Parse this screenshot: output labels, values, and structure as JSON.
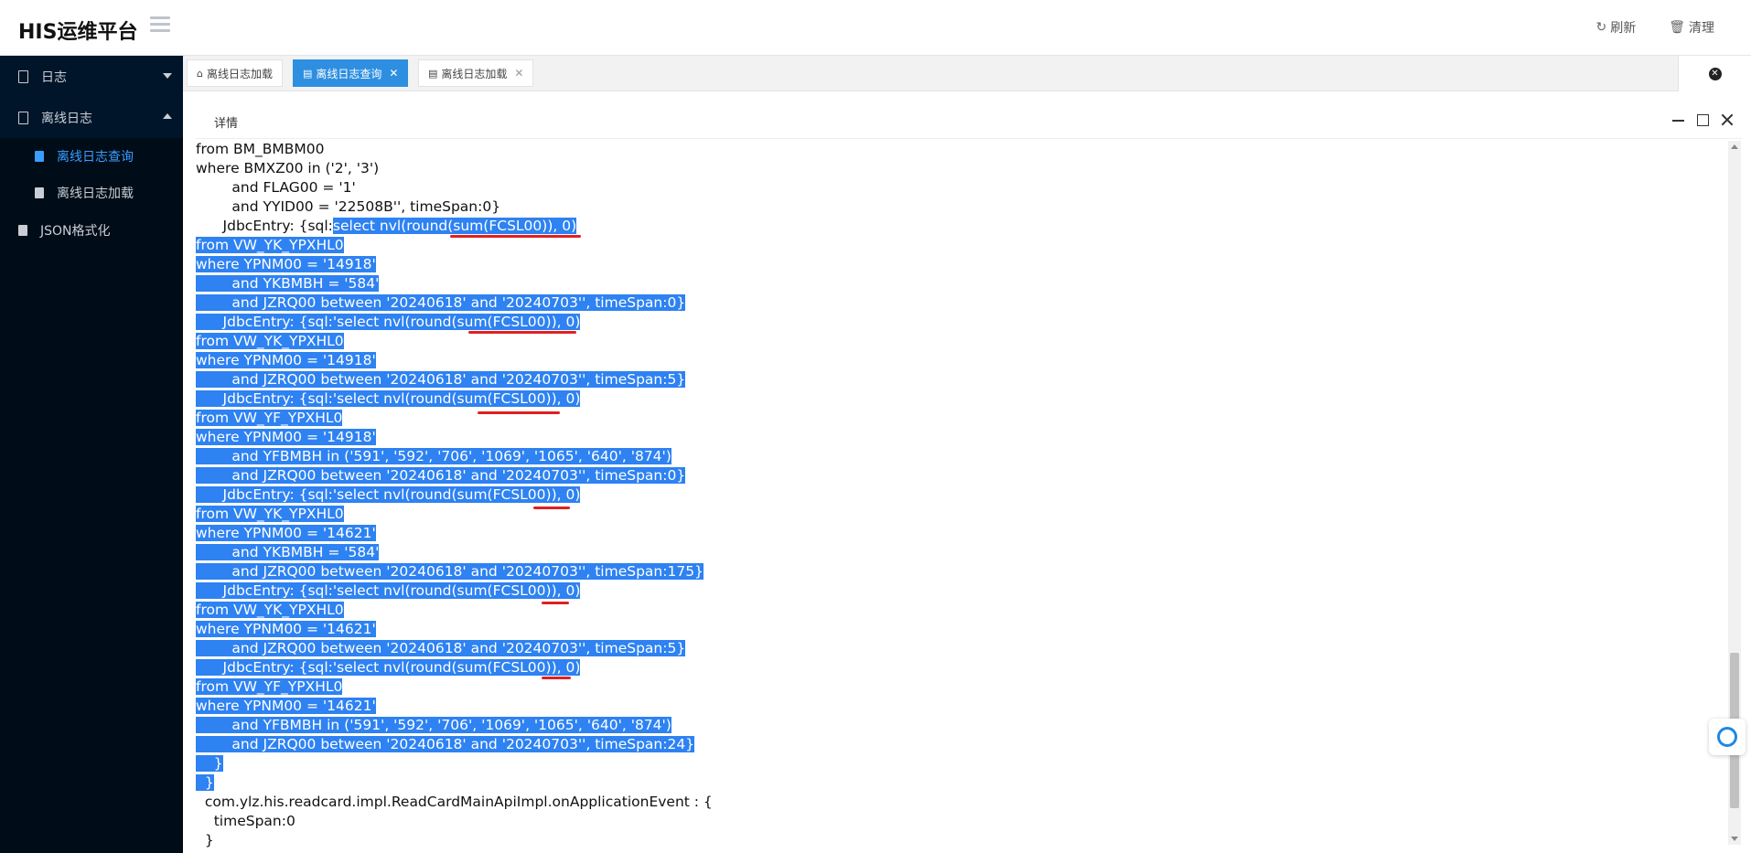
{
  "header": {
    "title": "HIS运维平台",
    "refresh_label": "刷新",
    "clear_label": "清理"
  },
  "sidebar": {
    "items": [
      {
        "label": "日志"
      },
      {
        "label": "离线日志"
      },
      {
        "label": "离线日志查询"
      },
      {
        "label": "离线日志加载"
      },
      {
        "label": "JSON格式化"
      }
    ]
  },
  "tabs": [
    {
      "label": "离线日志加载"
    },
    {
      "label": "离线日志查询"
    },
    {
      "label": "离线日志加载"
    }
  ],
  "panel": {
    "title": "详情"
  },
  "log": {
    "lines": [
      "from BM_BMBM00",
      "where BMXZ00 in ('2', '3')",
      "        and FLAG00 = '1'",
      "        and YYID00 = '22508B'', timeSpan:0}",
      "      JdbcEntry: {sql:",
      "from VW_YK_YPXHL0",
      "where YPNM00 = '14918'",
      "        and YKBMBH = '584'",
      "        and JZRQ00 between '20240618' and '20240703'', timeSpan:0}",
      "      JdbcEntry: {sql:'select nvl(round(sum(FCSL00)), 0)",
      "from VW_YK_YPXHL0",
      "where YPNM00 = '14918'",
      "        and JZRQ00 between '20240618' and '20240703'', timeSpan:5}",
      "      JdbcEntry: {sql:'select nvl(round(sum(FCSL00)), 0)",
      "from VW_YF_YPXHL0",
      "where YPNM00 = '14918'",
      "        and YFBMBH in ('591', '592', '706', '1069', '1065', '640', '874')",
      "        and JZRQ00 between '20240618' and '20240703'', timeSpan:0}",
      "      JdbcEntry: {sql:'select nvl(round(sum(FCSL00)), 0)",
      "from VW_YK_YPXHL0",
      "where YPNM00 = '14621'",
      "        and YKBMBH = '584'",
      "        and JZRQ00 between '20240618' and '20240703'', timeSpan:175}",
      "      JdbcEntry: {sql:'select nvl(round(sum(FCSL00)), 0)",
      "from VW_YK_YPXHL0",
      "where YPNM00 = '14621'",
      "        and JZRQ00 between '20240618' and '20240703'', timeSpan:5}",
      "      JdbcEntry: {sql:'select nvl(round(sum(FCSL00)), 0)",
      "from VW_YF_YPXHL0",
      "where YPNM00 = '14621'",
      "        and YFBMBH in ('591', '592', '706', '1069', '1065', '640', '874')",
      "        and JZRQ00 between '20240618' and '20240703'', timeSpan:24}",
      "    }",
      "  }",
      "  com.ylz.his.readcard.impl.ReadCardMainApiImpl.onApplicationEvent : {",
      "    timeSpan:0",
      "  }"
    ],
    "line4_selected_part": "select nvl(round(sum(FCSL00)), 0)"
  }
}
